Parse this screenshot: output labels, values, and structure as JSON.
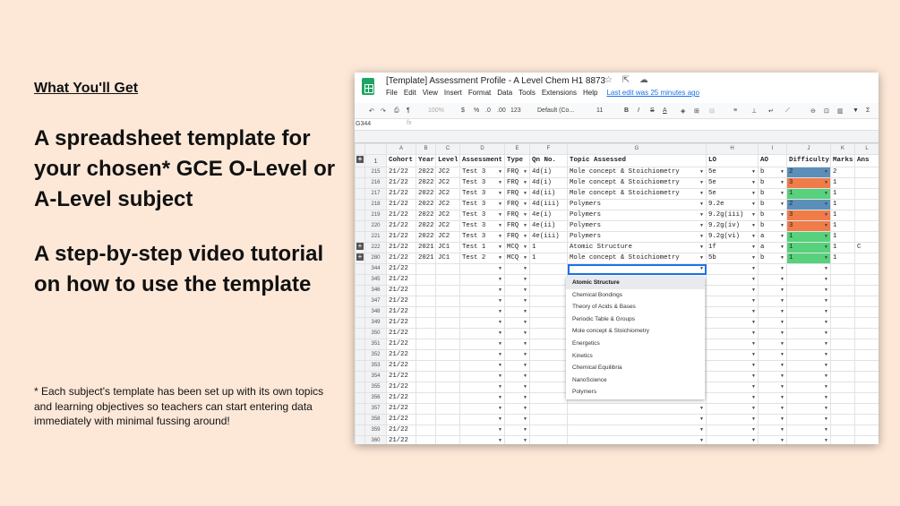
{
  "left": {
    "subheading": "What You'll Get",
    "heading1": "A spreadsheet template for your chosen* GCE O-Level or A-Level subject",
    "heading2": "A step-by-step video tutorial on how to use the template",
    "footnote": "* Each subject's template has been set up with its own topics and learning objectives so teachers can start entering data immediately with minimal fussing around!"
  },
  "sheet": {
    "title": "[Template] Assessment Profile - A Level Chem H1 8873",
    "title_icons": "☆ ⇱ ☁",
    "menu": [
      "File",
      "Edit",
      "View",
      "Insert",
      "Format",
      "Data",
      "Tools",
      "Extensions",
      "Help"
    ],
    "last_edit": "Last edit was 25 minutes ago",
    "toolbar": {
      "undo": "↶",
      "redo": "↷",
      "print": "⎙",
      "paint": "¶",
      "zoom": "100%",
      "currency": "$",
      "percent": "%",
      "dec_less": ".0",
      "dec_more": ".00",
      "more_formats": "123",
      "font": "Default (Co...",
      "size": "11",
      "bold": "B",
      "italic": "I",
      "strike": "S",
      "color": "A",
      "fill": "◈",
      "borders": "⊞",
      "merge": "⊟",
      "halign": "≡",
      "valign": "⊥",
      "wrap": "↵",
      "rotate": "⟋",
      "link": "⊖",
      "comment": "⊡",
      "chart": "▥",
      "filter": "▼",
      "functions": "Σ"
    },
    "namebox": "G344",
    "fx": "fx",
    "columns": [
      "A",
      "B",
      "C",
      "D",
      "E",
      "F",
      "G",
      "H",
      "I",
      "J",
      "K",
      "L"
    ],
    "header_row": {
      "row": "1",
      "cells": [
        "Cohort",
        "Year",
        "Level",
        "Assessment",
        "Type",
        "Qn No.",
        "Topic Assessed",
        "LO",
        "AO",
        "Difficulty",
        "Marks",
        "Ans"
      ]
    },
    "rows": [
      {
        "n": "215",
        "ctrl": "",
        "cells": [
          "21/22",
          "2022",
          "JC2",
          "Test 3",
          "FRQ",
          "4d(i)",
          "Mole concept & Stoichiometry",
          "5e",
          "b",
          "2",
          "2",
          ""
        ],
        "diff": "#5b8fb9"
      },
      {
        "n": "216",
        "ctrl": "",
        "cells": [
          "21/22",
          "2022",
          "JC2",
          "Test 3",
          "FRQ",
          "4d(i)",
          "Mole concept & Stoichiometry",
          "5e",
          "b",
          "3",
          "1",
          ""
        ],
        "diff": "#f07c4a"
      },
      {
        "n": "217",
        "ctrl": "",
        "cells": [
          "21/22",
          "2022",
          "JC2",
          "Test 3",
          "FRQ",
          "4d(ii)",
          "Mole concept & Stoichiometry",
          "5e",
          "b",
          "1",
          "1",
          ""
        ],
        "diff": "#57d17b"
      },
      {
        "n": "218",
        "ctrl": "",
        "cells": [
          "21/22",
          "2022",
          "JC2",
          "Test 3",
          "FRQ",
          "4d(iii)",
          "Polymers",
          "9.2e",
          "b",
          "2",
          "1",
          ""
        ],
        "diff": "#5b8fb9"
      },
      {
        "n": "219",
        "ctrl": "",
        "cells": [
          "21/22",
          "2022",
          "JC2",
          "Test 3",
          "FRQ",
          "4e(i)",
          "Polymers",
          "9.2g(iii)",
          "b",
          "3",
          "1",
          ""
        ],
        "diff": "#f07c4a"
      },
      {
        "n": "220",
        "ctrl": "",
        "cells": [
          "21/22",
          "2022",
          "JC2",
          "Test 3",
          "FRQ",
          "4e(ii)",
          "Polymers",
          "9.2g(iv)",
          "b",
          "3",
          "1",
          ""
        ],
        "diff": "#f07c4a"
      },
      {
        "n": "221",
        "ctrl": "",
        "cells": [
          "21/22",
          "2022",
          "JC2",
          "Test 3",
          "FRQ",
          "4e(iii)",
          "Polymers",
          "9.2g(vi)",
          "a",
          "1",
          "1",
          ""
        ],
        "diff": "#57d17b"
      },
      {
        "n": "222",
        "ctrl": "+",
        "cells": [
          "21/22",
          "2021",
          "JC1",
          "Test 1",
          "MCQ",
          "1",
          "Atomic Structure",
          "1f",
          "a",
          "1",
          "1",
          "C"
        ],
        "diff": "#57d17b"
      },
      {
        "n": "280",
        "ctrl": "+",
        "cells": [
          "21/22",
          "2021",
          "JC1",
          "Test 2",
          "MCQ",
          "1",
          "Mole concept & Stoichiometry",
          "5b",
          "b",
          "1",
          "1",
          ""
        ],
        "diff": "#57d17b"
      }
    ],
    "empty_rows": [
      "344",
      "345",
      "346",
      "347",
      "348",
      "349",
      "350",
      "351",
      "352",
      "353",
      "354",
      "355",
      "356",
      "357",
      "358",
      "359",
      "360"
    ],
    "empty_cohort": "21/22",
    "selected_row": "344",
    "dropdown_options": [
      "Atomic Structure",
      "Chemical Bondings",
      "Theory of Acids & Bases",
      "Periodic Table & Groups",
      "Mole concept & Stoichiometry",
      "Energetics",
      "Kinetics",
      "Chemical Equilibria",
      "NanoScience",
      "Polymers"
    ]
  }
}
